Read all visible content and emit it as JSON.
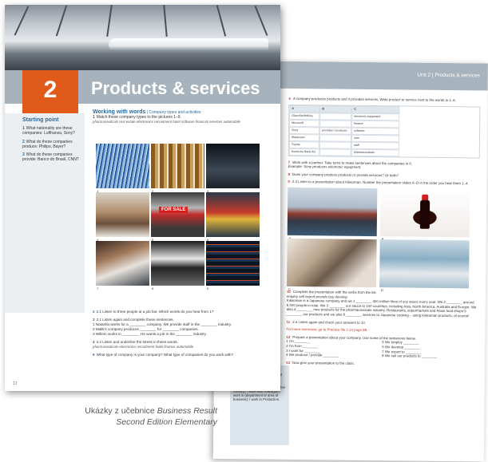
{
  "caption": {
    "line1_prefix": "Ukázky z učebnice ",
    "line1_title": "Business Result",
    "line2": "Second Edition Elementary"
  },
  "left_page": {
    "unit_number": "2",
    "unit_title": "Products & services",
    "starting_point": {
      "title": "Starting point",
      "items": [
        {
          "num": "1",
          "text": "What nationality are these companies: Lufthansa, Sony?"
        },
        {
          "num": "2",
          "text": "What do these companies produce: Philips, Bayer?"
        },
        {
          "num": "3",
          "text": "What do these companies provide: Banco do Brasil, CNN?"
        }
      ]
    },
    "working_with_words": {
      "title": "Working with words",
      "subtitle": " | Company types and activities",
      "q1_num": "1",
      "q1": "Match these company types to the pictures 1–9.",
      "word_list": "pharmaceuticals   real estate   electronics   recruitment   hotel   software   financial services   automobile"
    },
    "for_sale_sign": "FOR SALE",
    "questions": [
      {
        "num": "2",
        "text": "2.1 Listen to three people at a job fair. Which words do you hear from 1?"
      },
      {
        "num": "3",
        "text": "2.1 Listen again and complete these sentences."
      },
      {
        "num": "4",
        "text": "2.2 Listen and underline the stress in these words."
      },
      {
        "num": "5",
        "text": "What type of company is your company? What type of companies do you work with?"
      }
    ],
    "q3_lines": [
      "1  Natasha works for a ________ company. We provide staff in the ________ industry.",
      "2  Malik's company produces ________ for ________ companies.",
      "3  Willem works in ________. He wants a job in the ________ industry."
    ],
    "q4_words": "pharmaceuticals   electronics   recruitment   hotel   finance   automobile",
    "page_number": "12"
  },
  "right_page": {
    "header": "Unit 2 | Products & services",
    "q6": "A company produces products and it provides services. Write product or service next to the words in 1–6.",
    "table": {
      "headers": [
        "A",
        "B",
        "C"
      ],
      "col_a": [
        "GlaxoSmithKline",
        "Microsoft",
        "Sony",
        "Manpower",
        "Toyota",
        "Deutsche Bank AG"
      ],
      "col_b": "provides / produces",
      "col_c": [
        "electronic equipment",
        "finance",
        "software",
        "cars",
        "staff",
        "pharmaceuticals"
      ]
    },
    "q7": "Work with a partner. Take turns to make sentences about the companies in 6.",
    "q7_example": "Example: Sony produces electronic equipment.",
    "q8": "Does your company produce products or provide services? Or both?",
    "q9": "2.3 Listen to a presentation about Kikkoman. Number the presentation slides A–D in the order you hear them 1–4.",
    "photo_labels": [
      "A",
      "B",
      "C",
      "D"
    ],
    "q10": "Complete the presentation with the verbs from the list.",
    "q10_words": "employ   sell   export   provide   buy   develop",
    "q10_text": "Kikkoman is a Japanese company and we 1 ________ 400 million litres of soy sauce every year. We 2 ________ around 6,000 people in total. We 3 ________ our sauce to 100 countries, including Asia, North America, Australia and Europe. We also 4 ________ new products for the pharmaceuticals industry. Restaurants, supermarkets and Asian food shops 5 ________ our products and we also 6 ________ services to Japanese cooking – using Kikkoman products, of course!",
    "q11": "2.4 Listen again and check your answers to 10.",
    "more_exercises": "For more exercises, go to Practice file 2 on page 88.",
    "q12": "Prepare a presentation about your company. Use some of the sentences below.",
    "q12_left": [
      "1  I'm ________",
      "2  I'm from ________",
      "3  I work for ________",
      "4  We produce / provide ________"
    ],
    "q12_right": [
      "5  We employ ________",
      "6  We develop ________",
      "7  We export to ________",
      "8  We sell our products to ________"
    ],
    "q13": "Now give your presentation to the class.",
    "tip": {
      "title": "Tip | work + preposition",
      "text": "We use the verb work in different ways. work for (an employer/company): I work for BMW. work with (people or another country): I work with colleagues. work in (department or area of business): I work in Production."
    }
  }
}
